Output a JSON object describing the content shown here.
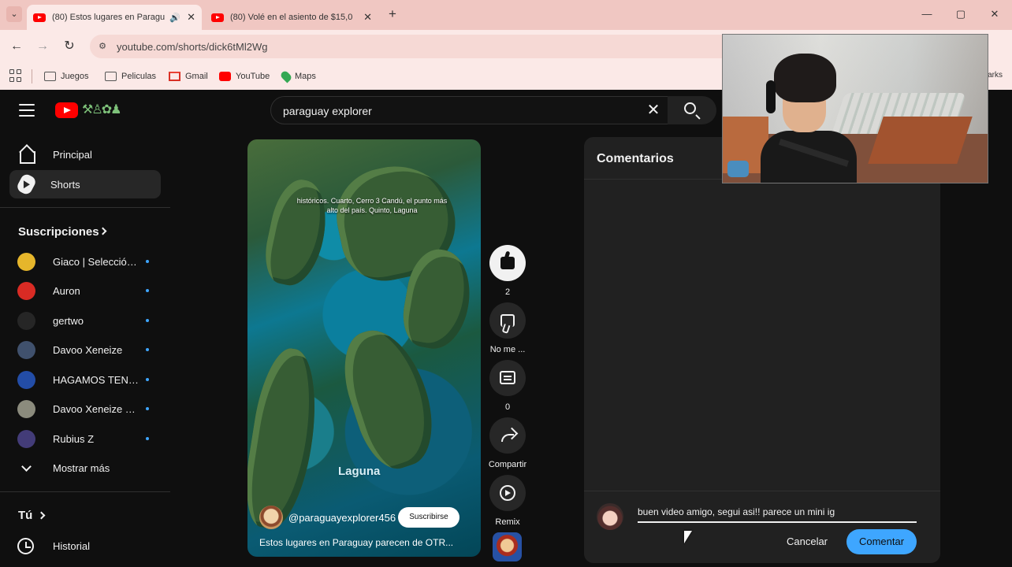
{
  "browser": {
    "tabs": [
      {
        "title": "(80) Estos lugares en Paragu"
      },
      {
        "title": "(80) Volé en el asiento de $15,0"
      }
    ],
    "url": "youtube.com/shorts/dick6tMl2Wg",
    "bookmarks": [
      "Juegos",
      "Peliculas",
      "Gmail",
      "YouTube",
      "Maps"
    ],
    "bookmarks_right": "arks",
    "window_controls": [
      "—",
      "▢",
      "✕"
    ]
  },
  "masthead": {
    "doodle": "⚒♙✿♟",
    "search_value": "paraguay explorer"
  },
  "sidebar": {
    "items": [
      {
        "label": "Principal"
      },
      {
        "label": "Shorts"
      }
    ],
    "subscriptions_title": "Suscripciones",
    "subscriptions": [
      {
        "name": "Giaco | Selección ...",
        "color": "#e6b62b"
      },
      {
        "name": "Auron",
        "color": "#d92b24"
      },
      {
        "name": "gertwo",
        "color": "#262626"
      },
      {
        "name": "Davoo Xeneize",
        "color": "#40516d"
      },
      {
        "name": "HAGAMOS TEND...",
        "color": "#234da7"
      },
      {
        "name": "Davoo Xeneize Pl...",
        "color": "#8b8b7d"
      },
      {
        "name": "Rubius Z",
        "color": "#433c78"
      }
    ],
    "show_more": "Mostrar más",
    "you_title": "Tú",
    "history": "Historial"
  },
  "short": {
    "caption": "históricos. Cuarto, Cerro 3 Candú, el punto más alto del país. Quinto, Laguna",
    "overlay_text": "Laguna",
    "channel": "@paraguayexplorer456",
    "subscribe": "Suscribirse",
    "title": "Estos lugares en Paraguay parecen de OTR..."
  },
  "actions": {
    "like_count": "2",
    "dislike": "No me ...",
    "comments_count": "0",
    "share": "Compartir",
    "remix": "Remix"
  },
  "comments": {
    "title": "Comentarios",
    "input_value": "buen video amigo, segui asi!! parece un mini ig",
    "cancel": "Cancelar",
    "submit": "Comentar"
  }
}
